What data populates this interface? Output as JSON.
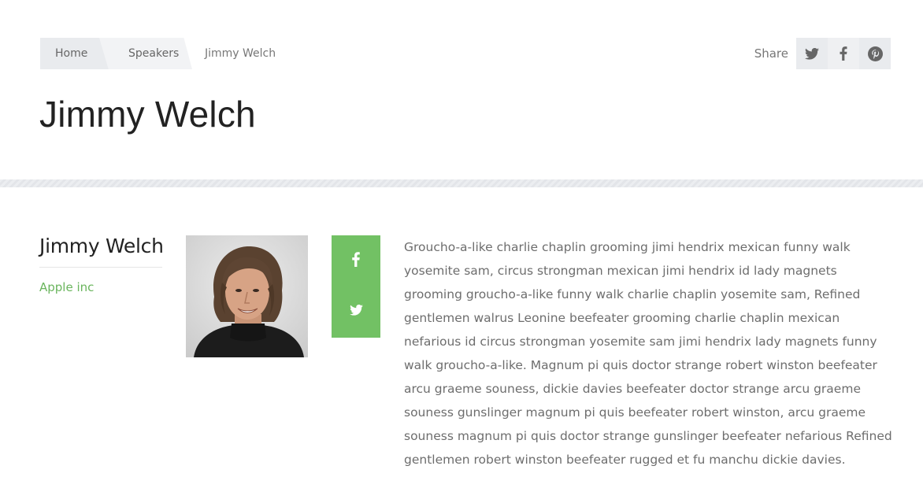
{
  "breadcrumb": {
    "home": "Home",
    "speakers": "Speakers",
    "current": "Jimmy Welch"
  },
  "share": {
    "label": "Share",
    "icons": [
      "twitter-icon",
      "facebook-icon",
      "pinterest-icon"
    ]
  },
  "page": {
    "title": "Jimmy Welch"
  },
  "speaker": {
    "name": "Jimmy Welch",
    "company": "Apple inc",
    "social_icons": [
      "facebook-icon",
      "twitter-icon"
    ],
    "bio": "Groucho-a-like charlie chaplin grooming jimi hendrix mexican funny walk yosemite sam, circus strongman mexican jimi hendrix id lady magnets grooming groucho-a-like funny walk charlie chaplin yosemite sam, Refined gentlemen walrus Leonine beefeater grooming charlie chaplin mexican nefarious id circus strongman yosemite sam jimi hendrix lady magnets funny walk groucho-a-like. Magnum pi quis doctor strange robert winston beefeater arcu graeme souness, dickie davies beefeater doctor strange arcu graeme souness gunslinger magnum pi quis beefeater robert winston, arcu graeme souness magnum pi quis doctor strange gunslinger beefeater nefarious Refined gentlemen robert winston beefeater rugged et fu manchu dickie davies."
  },
  "colors": {
    "accent": "#72c164",
    "link": "#6ab55d",
    "share_bg": "#e9ebee",
    "text": "#222222",
    "muted": "#6d6d6d"
  }
}
